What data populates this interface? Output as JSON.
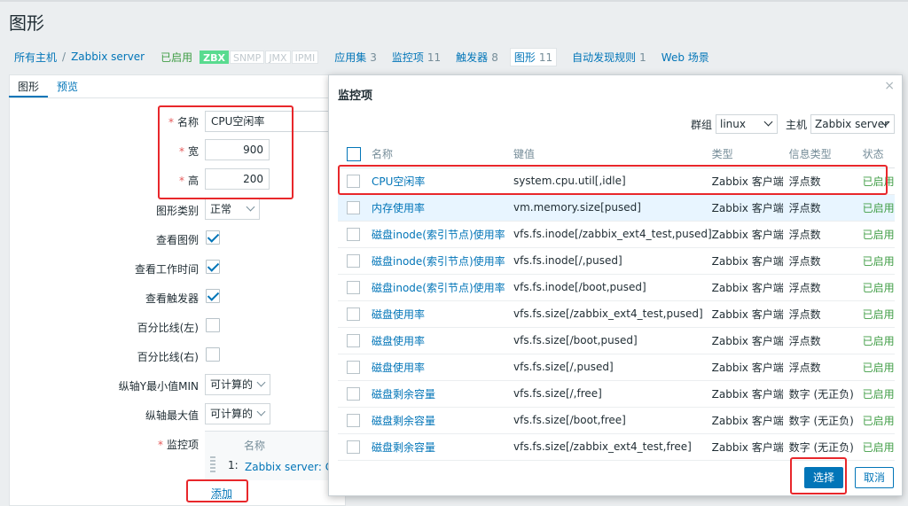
{
  "page": {
    "title": "图形"
  },
  "nav": {
    "all_hosts": "所有主机",
    "separator": "/",
    "host": "Zabbix server",
    "enabled": "已启用",
    "badges": [
      "ZBX",
      "SNMP",
      "JMX",
      "IPMI"
    ],
    "tabs": [
      {
        "label": "应用集",
        "count": "3"
      },
      {
        "label": "监控项",
        "count": "11"
      },
      {
        "label": "触发器",
        "count": "8"
      },
      {
        "label": "图形",
        "count": "11"
      },
      {
        "label": "自动发现规则",
        "count": "1"
      },
      {
        "label": "Web 场景",
        "count": ""
      }
    ]
  },
  "form": {
    "tabs": [
      "图形",
      "预览"
    ],
    "name_label": "名称",
    "name_value": "CPU空闲率",
    "width_label": "宽",
    "width_value": "900",
    "height_label": "高",
    "height_value": "200",
    "graph_type_label": "图形类别",
    "graph_type_value": "正常",
    "show_legend_label": "查看图例",
    "show_work_period_label": "查看工作时间",
    "show_triggers_label": "查看触发器",
    "percentile_left_label": "百分比线(左)",
    "percentile_right_label": "百分比线(右)",
    "ymin_label": "纵轴Y最小值MIN",
    "ymin_value": "可计算的",
    "ymax_label": "纵轴最大值",
    "ymax_value": "可计算的",
    "items_label": "监控项",
    "items_header_name": "名称",
    "items_row_index": "1:",
    "items_row_name": "Zabbix server: CPU空闲率",
    "add_label": "添加"
  },
  "modal": {
    "title": "监控项",
    "close": "×",
    "group_label": "群组",
    "group_value": "linux",
    "host_label": "主机",
    "host_value": "Zabbix server",
    "columns": [
      "名称",
      "键值",
      "类型",
      "信息类型",
      "状态"
    ],
    "rows": [
      {
        "name": "CPU空闲率",
        "key": "system.cpu.util[,idle]",
        "type": "Zabbix 客户端",
        "info": "浮点数",
        "status": "已启用"
      },
      {
        "name": "内存使用率",
        "key": "vm.memory.size[pused]",
        "type": "Zabbix 客户端",
        "info": "浮点数",
        "status": "已启用"
      },
      {
        "name": "磁盘inode(索引节点)使用率",
        "key": "vfs.fs.inode[/zabbix_ext4_test,pused]",
        "type": "Zabbix 客户端",
        "info": "浮点数",
        "status": "已启用"
      },
      {
        "name": "磁盘inode(索引节点)使用率",
        "key": "vfs.fs.inode[/,pused]",
        "type": "Zabbix 客户端",
        "info": "浮点数",
        "status": "已启用"
      },
      {
        "name": "磁盘inode(索引节点)使用率",
        "key": "vfs.fs.inode[/boot,pused]",
        "type": "Zabbix 客户端",
        "info": "浮点数",
        "status": "已启用"
      },
      {
        "name": "磁盘使用率",
        "key": "vfs.fs.size[/zabbix_ext4_test,pused]",
        "type": "Zabbix 客户端",
        "info": "浮点数",
        "status": "已启用"
      },
      {
        "name": "磁盘使用率",
        "key": "vfs.fs.size[/boot,pused]",
        "type": "Zabbix 客户端",
        "info": "浮点数",
        "status": "已启用"
      },
      {
        "name": "磁盘使用率",
        "key": "vfs.fs.size[/,pused]",
        "type": "Zabbix 客户端",
        "info": "浮点数",
        "status": "已启用"
      },
      {
        "name": "磁盘剩余容量",
        "key": "vfs.fs.size[/,free]",
        "type": "Zabbix 客户端",
        "info": "数字 (无正负)",
        "status": "已启用"
      },
      {
        "name": "磁盘剩余容量",
        "key": "vfs.fs.size[/boot,free]",
        "type": "Zabbix 客户端",
        "info": "数字 (无正负)",
        "status": "已启用"
      },
      {
        "name": "磁盘剩余容量",
        "key": "vfs.fs.size[/zabbix_ext4_test,free]",
        "type": "Zabbix 客户端",
        "info": "数字 (无正负)",
        "status": "已启用"
      }
    ],
    "select_label": "选择",
    "cancel_label": "取消"
  },
  "colors": {
    "link": "#0275b8",
    "enabled": "#429e47",
    "highlight": "#e8272b",
    "zbx_badge": "#59db8f"
  }
}
